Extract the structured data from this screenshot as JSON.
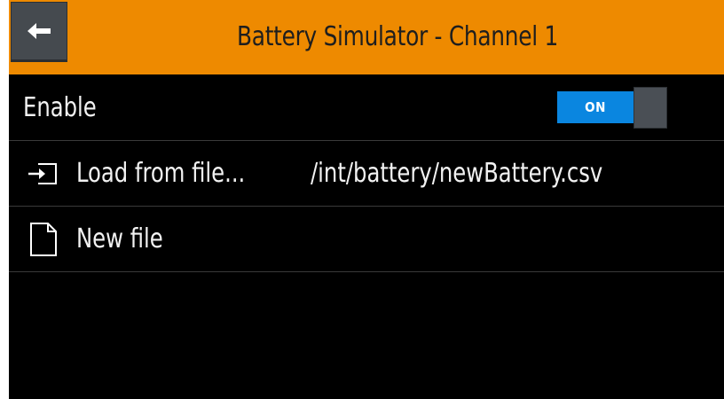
{
  "header": {
    "title": "Battery Simulator - Channel 1",
    "back_icon": "arrow-left-icon",
    "accent_color": "#ee8a00"
  },
  "rows": {
    "enable": {
      "label": "Enable",
      "toggle_state": "ON",
      "toggle_color": "#0a86e0"
    },
    "load": {
      "icon": "import-file-icon",
      "label": "Load from file...",
      "value": "/int/battery/newBattery.csv"
    },
    "new_file": {
      "icon": "new-document-icon",
      "label": "New file"
    }
  }
}
